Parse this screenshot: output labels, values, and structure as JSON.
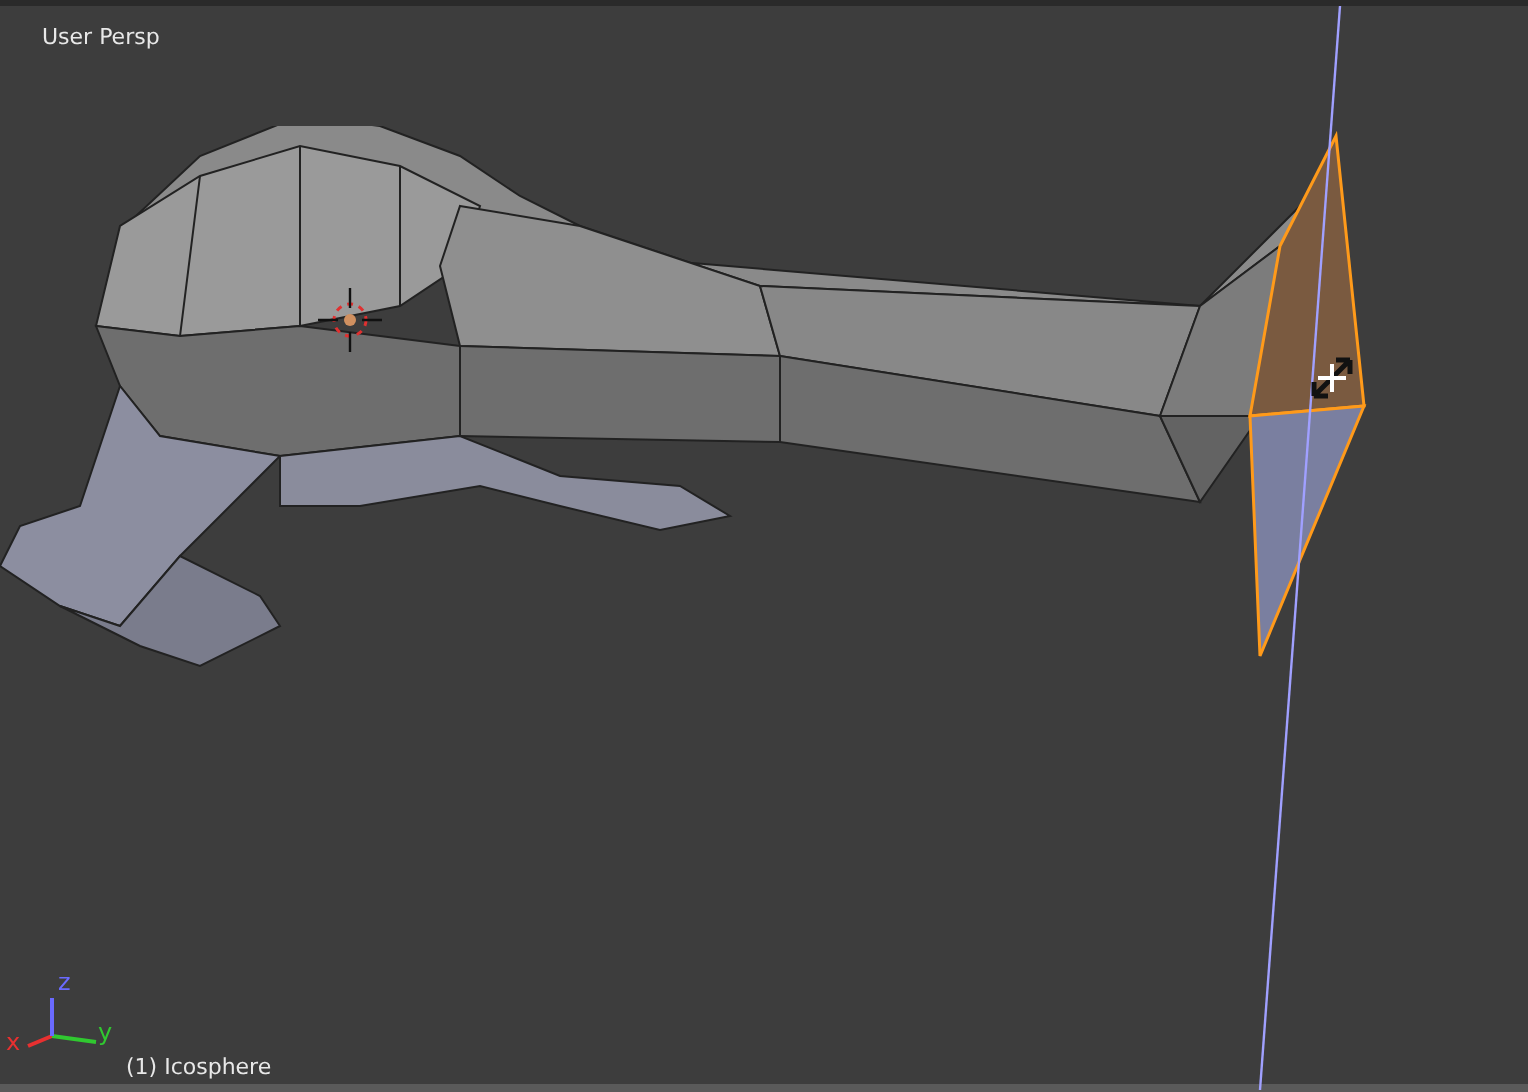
{
  "viewport": {
    "view_label": "User Persp",
    "object_label": "(1) Icosphere",
    "axes": [
      {
        "label": "x",
        "color": "#e83030"
      },
      {
        "label": "y",
        "color": "#30c830"
      },
      {
        "label": "z",
        "color": "#6a6aff"
      }
    ]
  }
}
